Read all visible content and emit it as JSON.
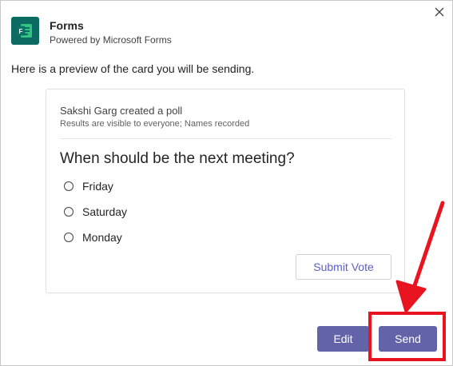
{
  "dialog": {
    "close_icon": "close-icon",
    "app_name": "Forms",
    "app_subtitle": "Powered by Microsoft Forms",
    "app_logo": "forms-logo",
    "intro_text": "Here is a preview of the card you will be sending."
  },
  "card": {
    "author_line": "Sakshi Garg created a poll",
    "visibility_note": "Results are visible to everyone; Names recorded",
    "question": "When should be the next meeting?",
    "options": [
      {
        "label": "Friday"
      },
      {
        "label": "Saturday"
      },
      {
        "label": "Monday"
      }
    ],
    "submit_label": "Submit Vote"
  },
  "footer": {
    "edit_label": "Edit",
    "send_label": "Send"
  },
  "colors": {
    "accent": "#6264a7",
    "submit_text": "#5b5fc7",
    "annotation_red": "#e8141f",
    "logo_bg": "#0b6a61"
  }
}
